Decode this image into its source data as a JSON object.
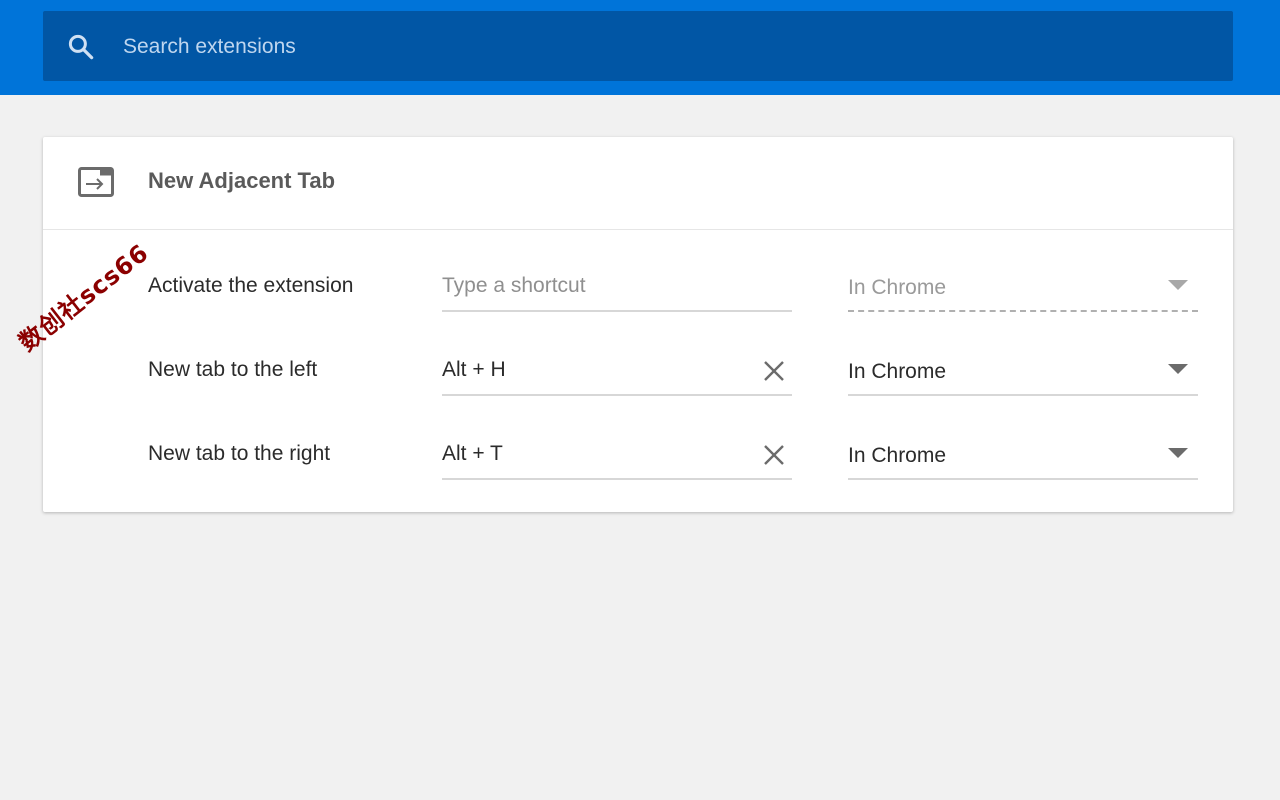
{
  "search": {
    "placeholder": "Search extensions",
    "icon": "search-icon"
  },
  "extension": {
    "title": "New Adjacent Tab",
    "icon": "open-in-new-tab-icon"
  },
  "shortcuts": [
    {
      "label": "Activate the extension",
      "shortcut_value": "",
      "shortcut_placeholder": "Type a shortcut",
      "scope": "In Chrome",
      "scope_disabled": true
    },
    {
      "label": "New tab to the left",
      "shortcut_value": "Alt + H",
      "scope": "In Chrome",
      "scope_disabled": false
    },
    {
      "label": "New tab to the right",
      "shortcut_value": "Alt + T",
      "scope": "In Chrome",
      "scope_disabled": false
    }
  ],
  "watermark": "数创社scs66",
  "colors": {
    "toolbar": "#0074d9",
    "searchbox": "#0156a5",
    "background": "#f1f1f1",
    "card": "#ffffff",
    "watermark": "#8b0000"
  }
}
